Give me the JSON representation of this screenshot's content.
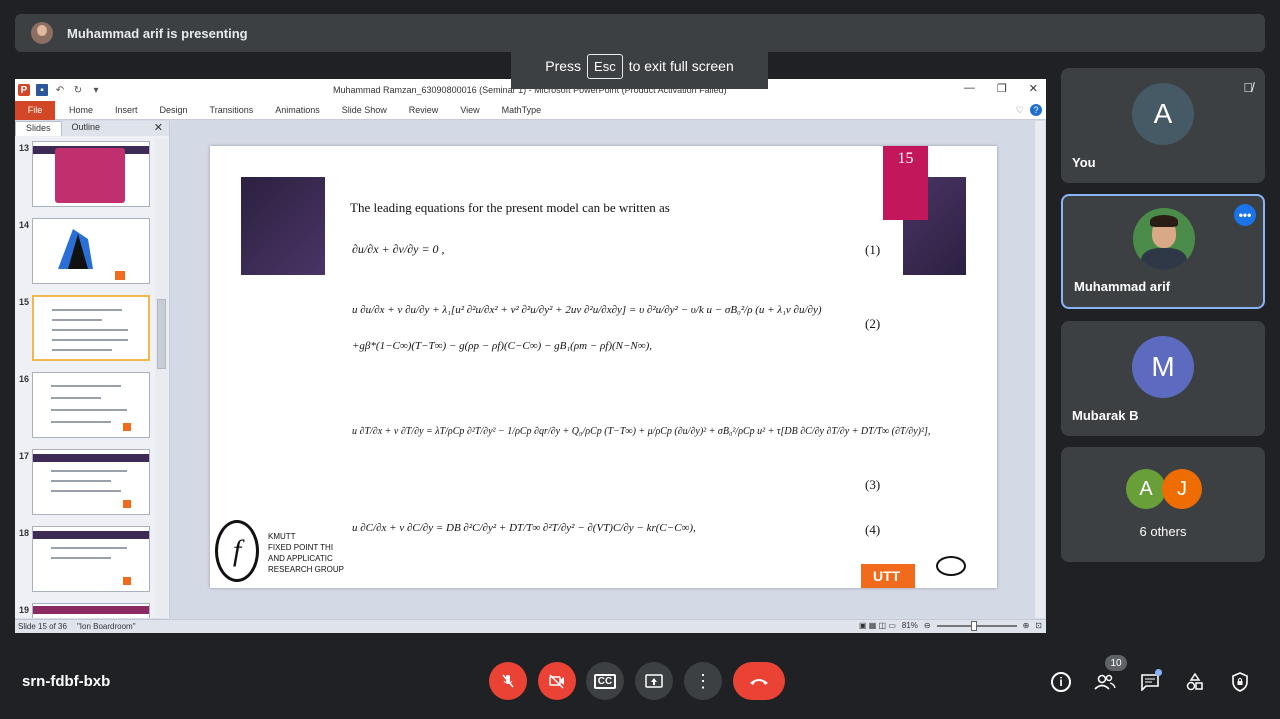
{
  "presenting": {
    "label": "Muhammad arif is presenting"
  },
  "fullscreen_toast": {
    "press": "Press",
    "key": "Esc",
    "suffix": "to exit full screen"
  },
  "powerpoint": {
    "window_title": "Muhammad Ramzan_63090800016 (Seminar 1)  -  Microsoft PowerPoint (Product Activation Failed)",
    "ribbon_tabs": [
      "File",
      "Home",
      "Insert",
      "Design",
      "Transitions",
      "Animations",
      "Slide Show",
      "Review",
      "View",
      "MathType"
    ],
    "pane_tabs": [
      "Slides",
      "Outline"
    ],
    "thumbnails": [
      {
        "num": "13"
      },
      {
        "num": "14"
      },
      {
        "num": "15"
      },
      {
        "num": "16"
      },
      {
        "num": "17"
      },
      {
        "num": "18"
      },
      {
        "num": "19"
      }
    ],
    "slide": {
      "number": "15",
      "intro": "The leading equations for the present model can be written as",
      "eq_numbers": [
        "(1)",
        "(2)",
        "(3)",
        "(4)"
      ],
      "equations": {
        "eq1": "∂u/∂x + ∂v/∂y = 0 ,",
        "eq2a": "u ∂u/∂x + v ∂u/∂y + λ₁[u² ∂²u/∂x² + v² ∂²u/∂y² + 2uv ∂²u/∂x∂y] = υ ∂²u/∂y² − υ/k u − σB₀²/ρ (u + λ₁v ∂u/∂y)",
        "eq2b": "+gβ*(1−C∞)(T−T∞) − g(ρp − ρf)(C−C∞) − gB₁(ρm − ρf)(N−N∞),",
        "eq3": "u ∂T/∂x + v ∂T/∂y = λT/ρCp ∂²T/∂y² − 1/ρCp ∂qr/∂y + Q₀/ρCp (T−T∞) + μ/ρCp (∂u/∂y)² + σB₀²/ρCp u² + τ[DB ∂C/∂y ∂T/∂y + DT/T∞ (∂T/∂y)²],",
        "eq4": "u ∂C/∂x + v ∂C/∂y = DB ∂²C/∂y² + DT/T∞ ∂²T/∂y² − ∂(VT)C/∂y − kr(C−C∞),"
      },
      "logo_lines": [
        "KMUTT",
        "FIXED POINT THI",
        "AND APPLICATIC",
        "RESEARCH GROUP"
      ],
      "orange_tag": "UTT"
    },
    "status": {
      "slide_info": "Slide 15 of 36",
      "theme": "\"Ion Boardroom\"",
      "zoom": "81%"
    }
  },
  "participants": [
    {
      "name": "You",
      "initial": "A",
      "color": "#455a64",
      "muted": true
    },
    {
      "name": "Muhammad arif",
      "active": true
    },
    {
      "name": "Mubarak B",
      "initial": "M",
      "color": "#5c6bc0"
    }
  ],
  "others": {
    "label": "6 others",
    "initials": [
      "A",
      "J"
    ],
    "colors": [
      "#689f38",
      "#ef6c00"
    ]
  },
  "bottom": {
    "meeting_code": "srn-fdbf-bxb",
    "participant_count": "10"
  }
}
